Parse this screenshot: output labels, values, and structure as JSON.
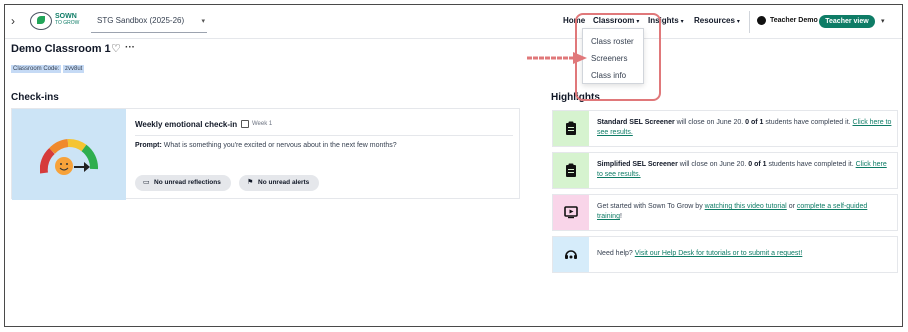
{
  "topbar": {
    "org_select": "STG Sandbox (2025-26)",
    "logo_line1": "SOWN",
    "logo_line2": "TO GROW",
    "nav": {
      "home": "Home",
      "classroom": "Classroom",
      "insights": "Insights",
      "resources": "Resources"
    },
    "teacher_name": "Teacher Demo",
    "teacher_view": "Teacher view"
  },
  "classroom_menu": {
    "items": [
      "Class roster",
      "Screeners",
      "Class info"
    ]
  },
  "classroom": {
    "title": "Demo Classroom 1",
    "code_label": "Classroom Code:",
    "code_value": "zvv8ut"
  },
  "checkins": {
    "section_title": "Check-ins",
    "card": {
      "title": "Weekly emotional check-in",
      "week": "Week 1",
      "prompt_label": "Prompt:",
      "prompt_text": "What is something you're excited or nervous about in the next few months?",
      "pill_reflections": "No unread reflections",
      "pill_alerts": "No unread alerts"
    }
  },
  "highlights": {
    "section_title": "Highlights",
    "items": [
      {
        "bold": "Standard SEL Screener",
        "mid": " will close on June 20. ",
        "count": "0 of 1",
        "after": " students have completed it. ",
        "link": "Click here to see results."
      },
      {
        "bold": "Simplified SEL Screener",
        "mid": " will close on June 20. ",
        "count": "0 of 1",
        "after": " students have completed it. ",
        "link": "Click here to see results."
      },
      {
        "pre": "Get started with Sown To Grow by ",
        "link1": "watching this video tutorial",
        "mid": " or ",
        "link2": "complete a self-guided training",
        "post": "!"
      },
      {
        "pre": "Need help? ",
        "link": "Visit our Help Desk for tutorials or to submit a request!"
      }
    ]
  },
  "colors": {
    "brand": "#0e7c66",
    "annotation": "#e0787a"
  }
}
